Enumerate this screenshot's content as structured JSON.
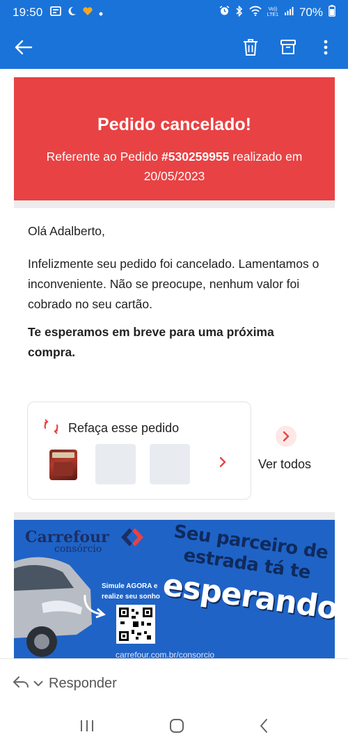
{
  "status_bar": {
    "time": "19:50",
    "battery": "70%",
    "left_icons": [
      "gallery-icon",
      "moon-icon",
      "heart-icon",
      "dot-icon"
    ],
    "right_icons": [
      "alarm-icon",
      "bluetooth-icon",
      "wifi-icon",
      "volte-icon",
      "signal-icon",
      "battery-icon"
    ],
    "volte_label_top": "Vo))",
    "volte_label_bottom": "LTE1"
  },
  "app_bar": {
    "icons": [
      "back-arrow-icon",
      "delete-icon",
      "archive-icon",
      "more-vertical-icon"
    ],
    "color": "#1a73d9"
  },
  "email": {
    "banner": {
      "title": "Pedido cancelado!",
      "ref_prefix": "Referente ao Pedido ",
      "order_number": "#530259955",
      "ref_suffix": " realizado em",
      "date": "20/05/2023",
      "color": "#e84244"
    },
    "greeting": "Olá Adalberto,",
    "message": "Infelizmente seu pedido foi cancelado. Lamentamos o inconveniente. Não se preocupe, nenhum valor foi cobrado no seu cartão.",
    "closing": "Te esperamos em breve para uma próxima compra.",
    "reorder": {
      "label": "Refaça esse pedido",
      "see_all": "Ver todos"
    },
    "ad": {
      "brand": "Carrefour",
      "brand_sub": "consórcio",
      "tagline_1": "Seu parceiro de",
      "tagline_2": "estrada tá te",
      "tagline_3": "esperando",
      "cta_1": "Simule AGORA e",
      "cta_2": "realize seu sonho",
      "url": "carrefour.com.br/consorcio"
    }
  },
  "reply_bar": {
    "label": "Responder"
  },
  "nav_bar": {
    "icons": [
      "recent-apps-icon",
      "home-icon",
      "back-icon"
    ]
  }
}
